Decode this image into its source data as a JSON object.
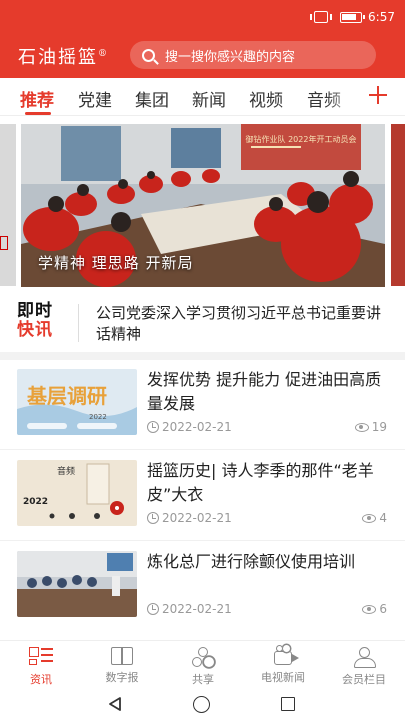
{
  "status_bar": {
    "time": "6:57"
  },
  "header": {
    "app_name": "石油摇篮",
    "registered_mark": "®",
    "search_placeholder": "搜一搜你感兴趣的内容"
  },
  "tabs": [
    {
      "label": "推荐",
      "active": true
    },
    {
      "label": "党建",
      "active": false
    },
    {
      "label": "集团",
      "active": false
    },
    {
      "label": "新闻",
      "active": false
    },
    {
      "label": "视频",
      "active": false
    },
    {
      "label": "音频",
      "active": false
    }
  ],
  "carousel": {
    "caption": "学精神 理思路 开新局",
    "banner_text": "御钻作业队 2022年开工动员会"
  },
  "news_flash": {
    "logo_line1": "即时",
    "logo_line2": "快讯",
    "headline": "公司党委深入学习贯彻习近平总书记重要讲话精神"
  },
  "articles": [
    {
      "title": "发挥优势 提升能力 促进油田高质量发展",
      "date": "2022-02-21",
      "views": "19",
      "thumb_text": "基层调研",
      "thumb_sub": "2022"
    },
    {
      "title": "摇篮历史| 诗人李季的那件“老羊皮”大衣",
      "date": "2022-02-21",
      "views": "4",
      "thumb_text": "音频",
      "thumb_sub": "2022"
    },
    {
      "title": "炼化总厂进行除颤仪使用培训",
      "date": "2022-02-21",
      "views": "6",
      "thumb_text": "",
      "thumb_sub": ""
    }
  ],
  "bottom_nav": [
    {
      "label": "资讯",
      "icon": "news-icon",
      "active": true
    },
    {
      "label": "数字报",
      "icon": "newspaper-icon",
      "active": false
    },
    {
      "label": "共享",
      "icon": "share-icon",
      "active": false
    },
    {
      "label": "电视新闻",
      "icon": "tv-icon",
      "active": false
    },
    {
      "label": "会员栏目",
      "icon": "user-icon",
      "active": false
    }
  ],
  "colors": {
    "brand_red": "#e53b2c",
    "text_gray": "#999999"
  }
}
